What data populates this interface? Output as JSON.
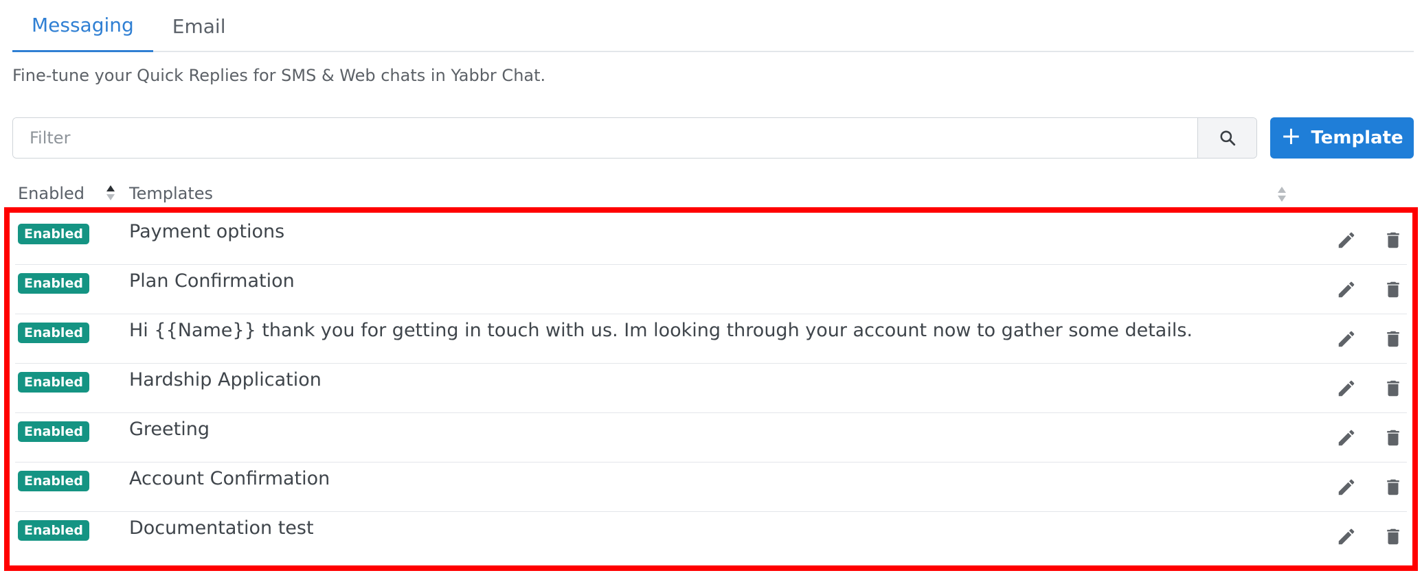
{
  "tabs": [
    {
      "label": "Messaging",
      "active": true
    },
    {
      "label": "Email",
      "active": false
    }
  ],
  "description": "Fine-tune your Quick Replies for SMS & Web chats in Yabbr Chat.",
  "filter": {
    "placeholder": "Filter",
    "value": ""
  },
  "add_button": {
    "plus": "+",
    "label": "Template"
  },
  "table": {
    "columns": [
      "Enabled",
      "Templates"
    ],
    "rows": [
      {
        "status": "Enabled",
        "title": "Payment options"
      },
      {
        "status": "Enabled",
        "title": "Plan Confirmation"
      },
      {
        "status": "Enabled",
        "title": "Hi {{Name}} thank you for getting in touch with us. Im looking through your account now to gather some details."
      },
      {
        "status": "Enabled",
        "title": "Hardship Application"
      },
      {
        "status": "Enabled",
        "title": "Greeting"
      },
      {
        "status": "Enabled",
        "title": "Account Confirmation"
      },
      {
        "status": "Enabled",
        "title": "Documentation test"
      }
    ]
  },
  "icons": {
    "search": "search-icon",
    "sort": "sort-icon",
    "edit": "pencil-icon",
    "delete": "trash-icon"
  },
  "colors": {
    "primary": "#1f7ed8",
    "active_tab": "#2f7fd3",
    "badge": "#159483",
    "highlight": "#ff0000",
    "icon": "#5f6368"
  }
}
